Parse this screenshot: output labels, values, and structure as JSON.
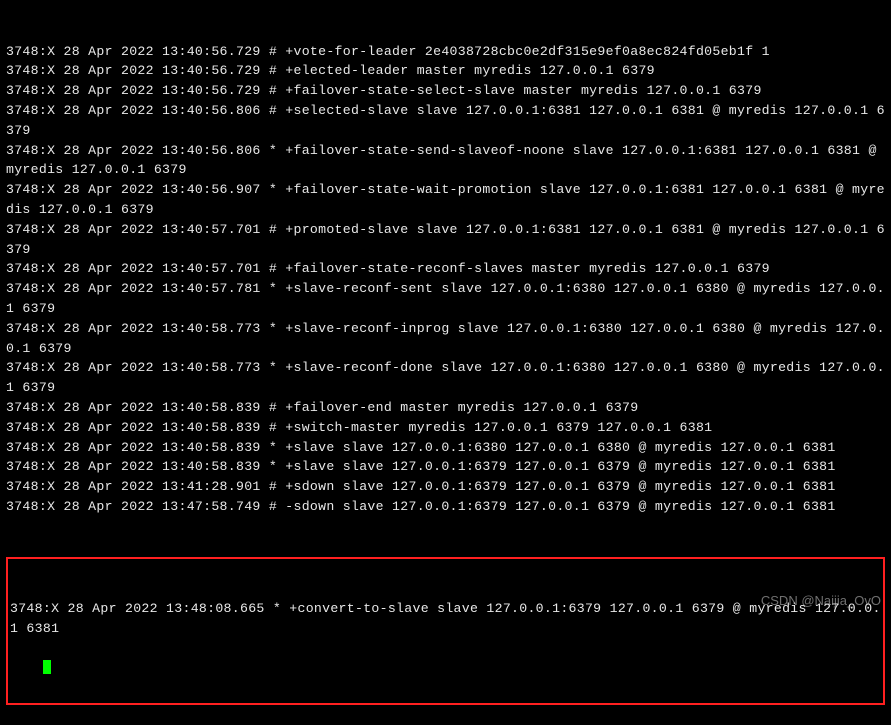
{
  "log_lines": [
    "3748:X 28 Apr 2022 13:40:56.729 # +vote-for-leader 2e4038728cbc0e2df315e9ef0a8ec824fd05eb1f 1",
    "3748:X 28 Apr 2022 13:40:56.729 # +elected-leader master myredis 127.0.0.1 6379",
    "3748:X 28 Apr 2022 13:40:56.729 # +failover-state-select-slave master myredis 127.0.0.1 6379",
    "3748:X 28 Apr 2022 13:40:56.806 # +selected-slave slave 127.0.0.1:6381 127.0.0.1 6381 @ myredis 127.0.0.1 6379",
    "3748:X 28 Apr 2022 13:40:56.806 * +failover-state-send-slaveof-noone slave 127.0.0.1:6381 127.0.0.1 6381 @ myredis 127.0.0.1 6379",
    "3748:X 28 Apr 2022 13:40:56.907 * +failover-state-wait-promotion slave 127.0.0.1:6381 127.0.0.1 6381 @ myredis 127.0.0.1 6379",
    "3748:X 28 Apr 2022 13:40:57.701 # +promoted-slave slave 127.0.0.1:6381 127.0.0.1 6381 @ myredis 127.0.0.1 6379",
    "3748:X 28 Apr 2022 13:40:57.701 # +failover-state-reconf-slaves master myredis 127.0.0.1 6379",
    "3748:X 28 Apr 2022 13:40:57.781 * +slave-reconf-sent slave 127.0.0.1:6380 127.0.0.1 6380 @ myredis 127.0.0.1 6379",
    "3748:X 28 Apr 2022 13:40:58.773 * +slave-reconf-inprog slave 127.0.0.1:6380 127.0.0.1 6380 @ myredis 127.0.0.1 6379",
    "3748:X 28 Apr 2022 13:40:58.773 * +slave-reconf-done slave 127.0.0.1:6380 127.0.0.1 6380 @ myredis 127.0.0.1 6379",
    "3748:X 28 Apr 2022 13:40:58.839 # +failover-end master myredis 127.0.0.1 6379",
    "3748:X 28 Apr 2022 13:40:58.839 # +switch-master myredis 127.0.0.1 6379 127.0.0.1 6381",
    "3748:X 28 Apr 2022 13:40:58.839 * +slave slave 127.0.0.1:6380 127.0.0.1 6380 @ myredis 127.0.0.1 6381",
    "3748:X 28 Apr 2022 13:40:58.839 * +slave slave 127.0.0.1:6379 127.0.0.1 6379 @ myredis 127.0.0.1 6381",
    "3748:X 28 Apr 2022 13:41:28.901 # +sdown slave 127.0.0.1:6379 127.0.0.1 6379 @ myredis 127.0.0.1 6381",
    "3748:X 28 Apr 2022 13:47:58.749 # -sdown slave 127.0.0.1:6379 127.0.0.1 6379 @ myredis 127.0.0.1 6381"
  ],
  "highlighted_line": "3748:X 28 Apr 2022 13:48:08.665 * +convert-to-slave slave 127.0.0.1:6379 127.0.0.1 6379 @ myredis 127.0.0.1 6381",
  "watermark": "CSDN @Naijia_OvO"
}
